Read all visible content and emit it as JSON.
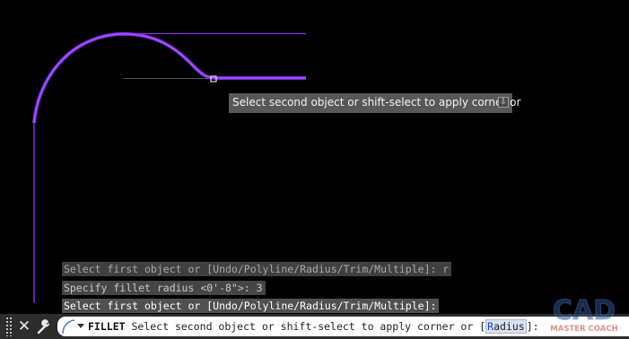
{
  "tooltip": {
    "text": "Select second object or shift-select to apply corner or",
    "icon": "download-arrow-icon"
  },
  "history": {
    "line1": "Select first object or [Undo/Polyline/Radius/Trim/Multiple]: r",
    "line2": "Specify fillet radius <0'-8\">: 3",
    "line3": "Select first object or [Undo/Polyline/Radius/Trim/Multiple]:"
  },
  "command_line": {
    "command": "FILLET",
    "prompt": "Select second object or shift-select to apply corner or [",
    "option_key": "R",
    "option_rest": "adius",
    "suffix": "]:",
    "close_icon": "close-icon",
    "customize_icon": "wrench-icon",
    "recent_icon": "fillet-arc-icon"
  },
  "watermark": {
    "top": "CAD",
    "bottom": "MASTER COACH"
  },
  "colors": {
    "background": "#000000",
    "geometry": "#8a2be2",
    "highlight": "#a64dff",
    "tooltip_bg": "#585858"
  }
}
